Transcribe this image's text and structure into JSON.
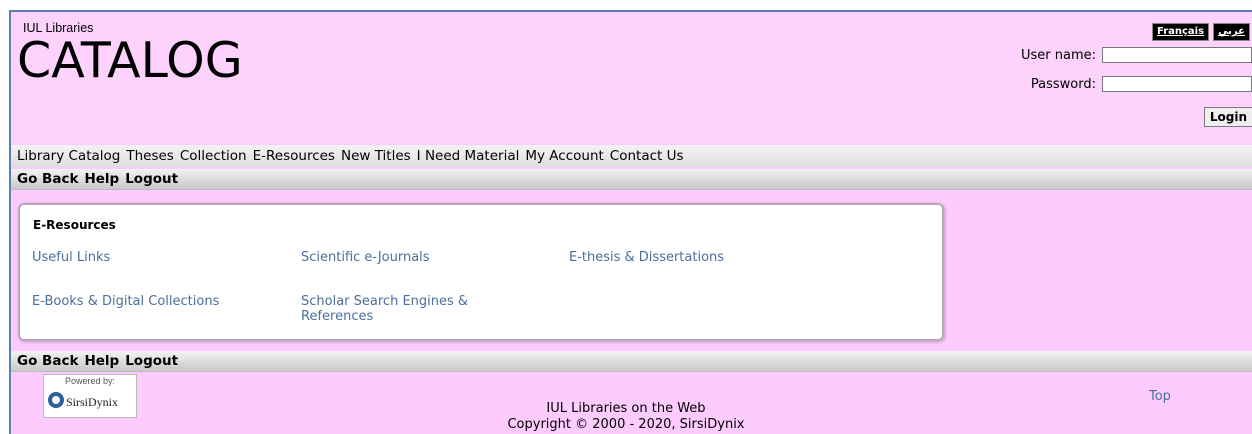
{
  "header": {
    "org": "IUL Libraries",
    "title": "CATALOG",
    "lang_french": "Français",
    "lang_arabic": "عربي",
    "username_label": "User name:",
    "password_label": "Password:",
    "login_label": "Login"
  },
  "nav": {
    "items": [
      "Library Catalog",
      "Theses",
      "Collection",
      "E-Resources",
      "New Titles",
      "I Need Material",
      "My Account",
      "Contact Us"
    ]
  },
  "subnav": {
    "go_back": "Go Back",
    "help": "Help",
    "logout": "Logout"
  },
  "panel": {
    "title": "E-Resources",
    "links": [
      "Useful Links",
      "Scientific e-Journals",
      "E-thesis & Dissertations",
      "E-Books & Digital Collections",
      "Scholar Search Engines & References"
    ]
  },
  "footer": {
    "powered_by": "Powered by:",
    "brand": "SirsiDynix",
    "line1": "IUL Libraries on the Web",
    "line2": "Copyright © 2000 - 2020, SirsiDynix",
    "top": "Top"
  },
  "colors": {
    "background": "#fecbfe",
    "link": "#4a6f9b",
    "frame_border": "#5b7fae"
  }
}
